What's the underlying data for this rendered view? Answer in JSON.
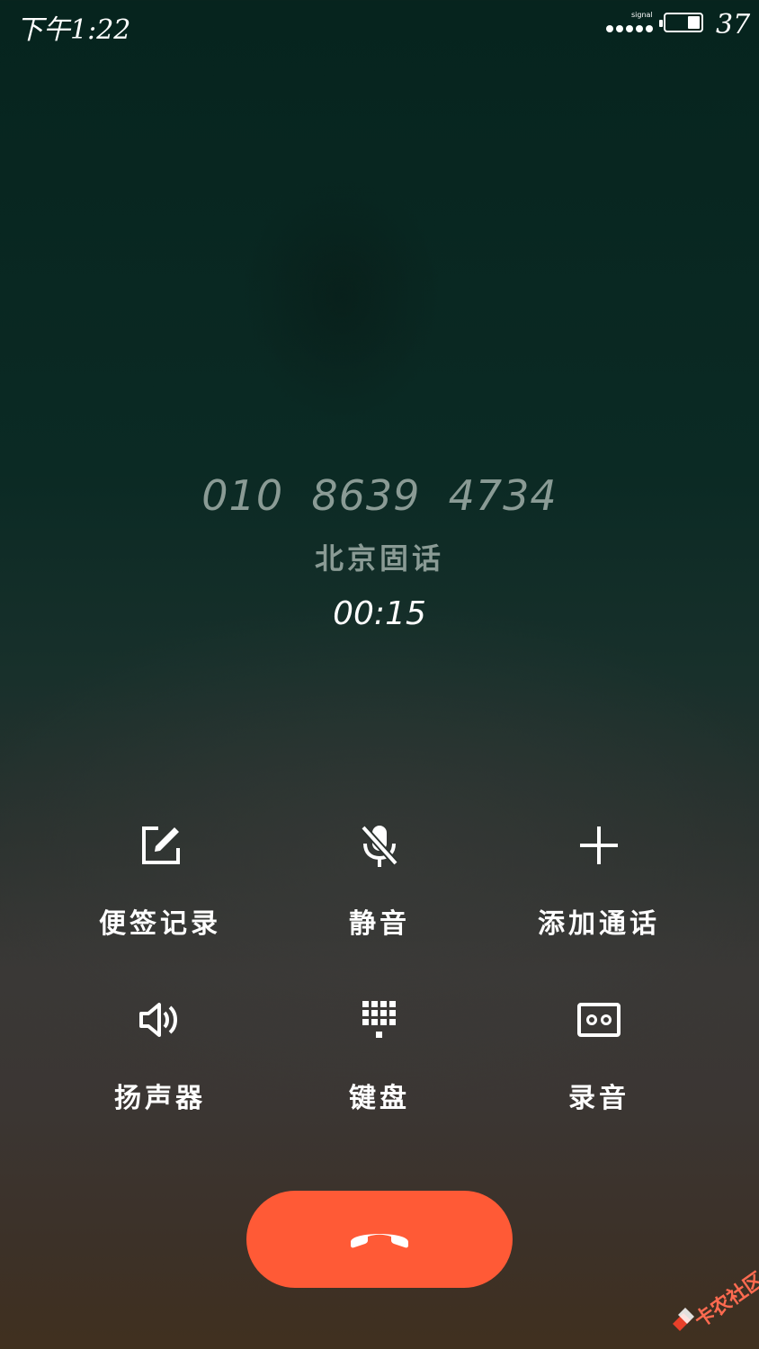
{
  "status_bar": {
    "time": "下午1:22",
    "signal_label": "signal",
    "battery_level": "37",
    "battery_fraction": 0.37
  },
  "caller": {
    "number": "010  8639  4734",
    "location": "北京固话",
    "duration": "00:15"
  },
  "controls": [
    {
      "icon": "note-edit-icon",
      "label": "便签记录"
    },
    {
      "icon": "mute-mic-icon",
      "label": "静音"
    },
    {
      "icon": "add-call-icon",
      "label": "添加通话"
    },
    {
      "icon": "speaker-icon",
      "label": "扬声器"
    },
    {
      "icon": "keypad-icon",
      "label": "键盘"
    },
    {
      "icon": "record-icon",
      "label": "录音"
    }
  ],
  "end_call": {
    "icon": "hangup-icon"
  },
  "watermark": {
    "text": "卡农社区"
  },
  "colors": {
    "end_call": "#ff5a36",
    "caller_text": "#8a9b95",
    "background_top": "#06241e",
    "background_bottom": "#40301f"
  }
}
